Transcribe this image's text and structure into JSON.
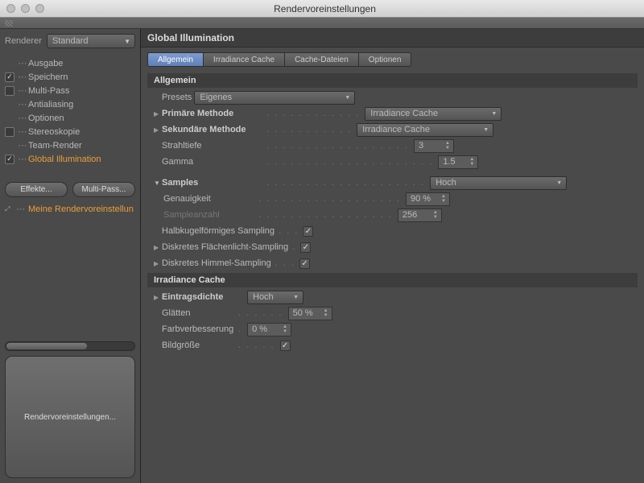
{
  "window": {
    "title": "Rendervoreinstellungen"
  },
  "sidebar": {
    "renderer_label": "Renderer",
    "renderer_value": "Standard",
    "items": [
      {
        "label": "Ausgabe",
        "check": "none"
      },
      {
        "label": "Speichern",
        "check": "on"
      },
      {
        "label": "Multi-Pass",
        "check": "off"
      },
      {
        "label": "Antialiasing",
        "check": "none"
      },
      {
        "label": "Optionen",
        "check": "none"
      },
      {
        "label": "Stereoskopie",
        "check": "off"
      },
      {
        "label": "Team-Render",
        "check": "none"
      },
      {
        "label": "Global Illumination",
        "check": "on",
        "selected": true
      }
    ],
    "effects_btn": "Effekte...",
    "multipass_btn": "Multi-Pass...",
    "preset_label": "Meine Rendervoreinstellun",
    "footer_btn": "Rendervoreinstellungen..."
  },
  "panel": {
    "title": "Global Illumination",
    "tabs": [
      "Allgemein",
      "Irradiance Cache",
      "Cache-Dateien",
      "Optionen"
    ],
    "active_tab": 0,
    "general_header": "Allgemein",
    "presets_label": "Presets",
    "presets_value": "Eigenes",
    "primary_label": "Primäre Methode",
    "primary_value": "Irradiance Cache",
    "secondary_label": "Sekundäre Methode",
    "secondary_value": "Irradiance Cache",
    "depth_label": "Strahltiefe",
    "depth_value": "3",
    "gamma_label": "Gamma",
    "gamma_value": "1.5",
    "samples_label": "Samples",
    "samples_value": "Hoch",
    "accuracy_label": "Genauigkeit",
    "accuracy_value": "90 %",
    "samplecount_label": "Sampleanzahl",
    "samplecount_value": "256",
    "hemi_label": "Halbkugelförmiges Sampling",
    "area_label": "Diskretes Flächenlicht-Sampling",
    "sky_label": "Diskretes Himmel-Sampling",
    "ic_header": "Irradiance Cache",
    "density_label": "Eintragsdichte",
    "density_value": "Hoch",
    "smooth_label": "Glätten",
    "smooth_value": "50 %",
    "colorref_label": "Farbverbesserung",
    "colorref_value": "0 %",
    "imgsize_label": "Bildgröße"
  }
}
